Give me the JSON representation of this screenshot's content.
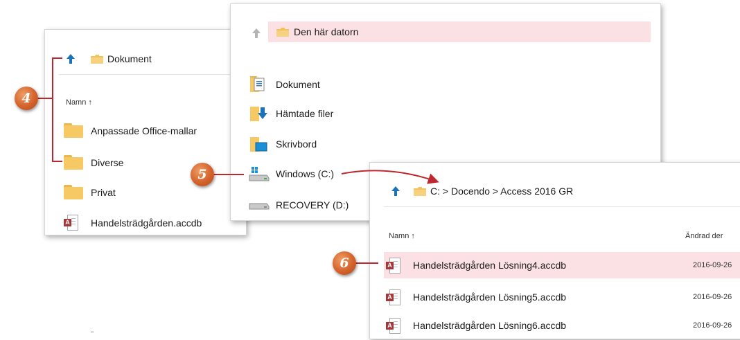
{
  "panel1": {
    "address": "Dokument",
    "header_name": "Namn ↑",
    "items": [
      {
        "label": "Anpassade Office-mallar",
        "icon": "folder-icon"
      },
      {
        "label": "Diverse",
        "icon": "folder-icon"
      },
      {
        "label": "Privat",
        "icon": "folder-icon"
      },
      {
        "label": "Handelsträdgården.accdb",
        "icon": "access-file-icon"
      }
    ]
  },
  "panel2": {
    "address": "Den här datorn",
    "items": [
      {
        "label": "Dokument",
        "icon": "documents-folder-icon"
      },
      {
        "label": "Hämtade filer",
        "icon": "downloads-folder-icon"
      },
      {
        "label": "Skrivbord",
        "icon": "desktop-folder-icon"
      },
      {
        "label": "Windows (C:)",
        "icon": "windows-drive-icon"
      },
      {
        "label": "RECOVERY (D:)",
        "icon": "drive-icon"
      }
    ]
  },
  "panel3": {
    "address": "C: > Docendo > Access 2016 GR",
    "header_name": "Namn ↑",
    "header_date": "Ändrad der",
    "rows": [
      {
        "name": "Handelsträdgården Lösning4.accdb",
        "date": "2016-09-26"
      },
      {
        "name": "Handelsträdgården Lösning5.accdb",
        "date": "2016-09-26"
      },
      {
        "name": "Handelsträdgården Lösning6.accdb",
        "date": "2016-09-26"
      }
    ]
  },
  "callouts": {
    "c4": "4",
    "c5": "5",
    "c6": "6"
  },
  "stray_mark": "¨",
  "colors": {
    "selection": "#fbe1e4",
    "up_arrow_active": "#1a73b8",
    "up_arrow_inactive": "#b4b4b4",
    "callout": "#d4622c",
    "connector": "#c0262e",
    "access_badge": "#a4373a",
    "folder": "#f6c965"
  }
}
